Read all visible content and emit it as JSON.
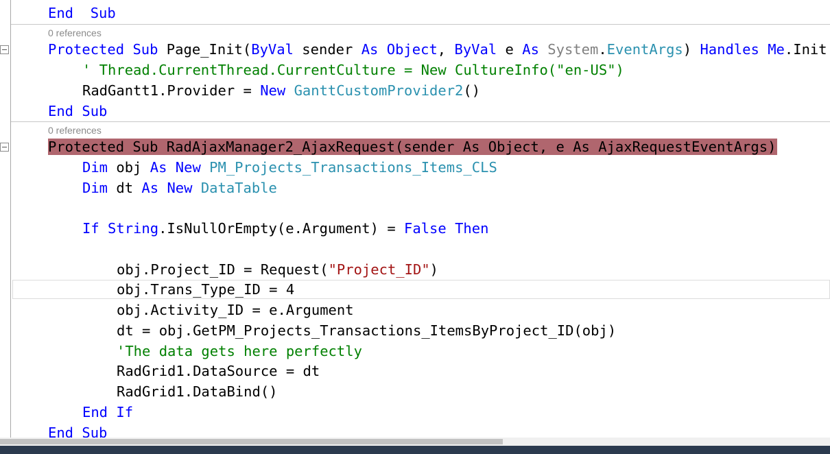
{
  "editor": {
    "codelens": [
      "0 references",
      "0 references"
    ],
    "lines": [
      {
        "tokens": [
          [
            "kw",
            "End"
          ],
          [
            "",
            "  "
          ],
          [
            "kw",
            "Sub"
          ]
        ]
      },
      {
        "tokens": [
          [
            "kw",
            "Protected"
          ],
          [
            "",
            " "
          ],
          [
            "kw",
            "Sub"
          ],
          [
            "",
            " Page_Init("
          ],
          [
            "kw",
            "ByVal"
          ],
          [
            "",
            " sender "
          ],
          [
            "kw",
            "As"
          ],
          [
            "",
            " "
          ],
          [
            "kw",
            "Object"
          ],
          [
            "",
            ", "
          ],
          [
            "kw",
            "ByVal"
          ],
          [
            "",
            " e "
          ],
          [
            "kw",
            "As"
          ],
          [
            "",
            " "
          ],
          [
            "gr",
            "System"
          ],
          [
            "",
            "."
          ],
          [
            "ty",
            "EventArgs"
          ],
          [
            "",
            ") "
          ],
          [
            "kw",
            "Handles"
          ],
          [
            "",
            " "
          ],
          [
            "kw",
            "Me"
          ],
          [
            "",
            ".Init"
          ]
        ]
      },
      {
        "tokens": [
          [
            "cm",
            "' Thread.CurrentThread.CurrentCulture = New CultureInfo(\"en-US\")"
          ]
        ]
      },
      {
        "tokens": [
          [
            "",
            "RadGantt1.Provider = "
          ],
          [
            "kw",
            "New"
          ],
          [
            "",
            " "
          ],
          [
            "ty",
            "GanttCustomProvider2"
          ],
          [
            "",
            "()"
          ]
        ]
      },
      {
        "tokens": [
          [
            "kw",
            "End"
          ],
          [
            "",
            " "
          ],
          [
            "kw",
            "Sub"
          ]
        ]
      },
      {
        "tokens": [
          [
            "hl",
            "Protected Sub RadAjaxManager2_AjaxRequest(sender As Object, e As AjaxRequestEventArgs)"
          ]
        ]
      },
      {
        "tokens": [
          [
            "kw",
            "Dim"
          ],
          [
            "",
            " obj "
          ],
          [
            "kw",
            "As"
          ],
          [
            "",
            " "
          ],
          [
            "kw",
            "New"
          ],
          [
            "",
            " "
          ],
          [
            "ty",
            "PM_Projects_Transactions_Items_CLS"
          ]
        ]
      },
      {
        "tokens": [
          [
            "kw",
            "Dim"
          ],
          [
            "",
            " dt "
          ],
          [
            "kw",
            "As"
          ],
          [
            "",
            " "
          ],
          [
            "kw",
            "New"
          ],
          [
            "",
            " "
          ],
          [
            "ty",
            "DataTable"
          ]
        ]
      },
      {
        "tokens": [
          [
            "kw",
            "If"
          ],
          [
            "",
            " "
          ],
          [
            "kw",
            "String"
          ],
          [
            "",
            ".IsNullOrEmpty(e.Argument) = "
          ],
          [
            "kw",
            "False"
          ],
          [
            "",
            " "
          ],
          [
            "kw",
            "Then"
          ]
        ]
      },
      {
        "tokens": [
          [
            "",
            "obj.Project_ID = Request("
          ],
          [
            "st",
            "\"Project_ID\""
          ],
          [
            "",
            ")"
          ]
        ]
      },
      {
        "tokens": [
          [
            "",
            "obj.Trans_Type_ID = 4"
          ]
        ]
      },
      {
        "tokens": [
          [
            "",
            "obj.Activity_ID = e.Argument"
          ]
        ]
      },
      {
        "tokens": [
          [
            "",
            "dt = obj.GetPM_Projects_Transactions_ItemsByProject_ID(obj)"
          ]
        ]
      },
      {
        "tokens": [
          [
            "cm",
            "'The data gets here perfectly"
          ]
        ]
      },
      {
        "tokens": [
          [
            "",
            "RadGrid1.DataSource = dt"
          ]
        ]
      },
      {
        "tokens": [
          [
            "",
            "RadGrid1.DataBind()"
          ]
        ]
      },
      {
        "tokens": [
          [
            "kw",
            "End"
          ],
          [
            "",
            " "
          ],
          [
            "kw",
            "If"
          ]
        ]
      },
      {
        "tokens": [
          [
            "kw",
            "End"
          ],
          [
            "",
            " "
          ],
          [
            "kw",
            "Sub"
          ]
        ]
      }
    ]
  },
  "colors": {
    "keyword": "#0000ff",
    "type": "#2b91af",
    "string": "#a31515",
    "comment": "#008000",
    "highlight": "#b0666e"
  }
}
